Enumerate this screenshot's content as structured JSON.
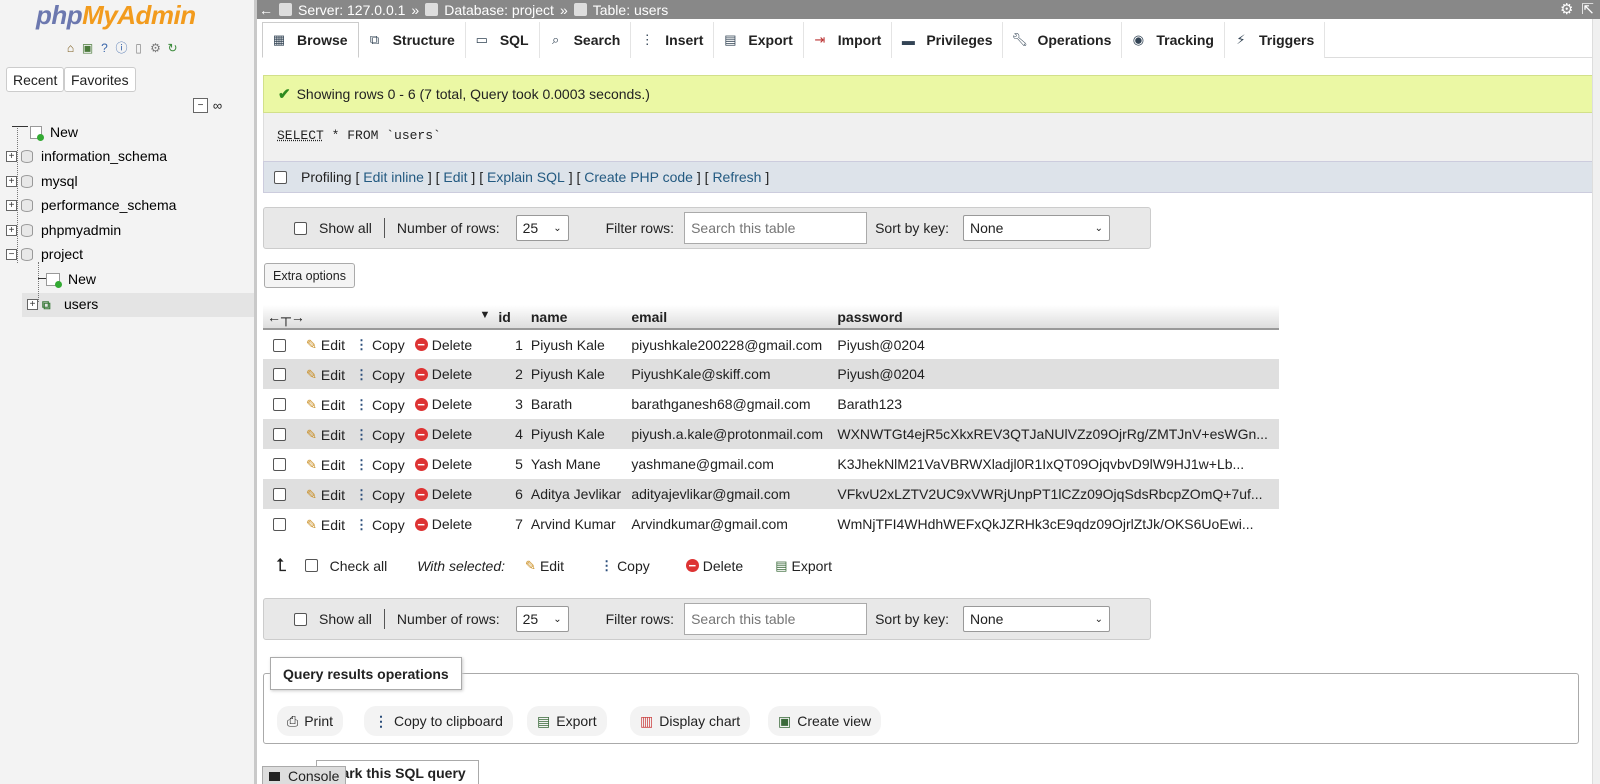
{
  "sidebar": {
    "logo_php": "php",
    "logo_myadmin": "MyAdmin",
    "recent_label": "Recent",
    "favorites_label": "Favorites",
    "tree": [
      {
        "label": "New"
      },
      {
        "label": "information_schema"
      },
      {
        "label": "mysql"
      },
      {
        "label": "performance_schema"
      },
      {
        "label": "phpmyadmin"
      },
      {
        "label": "project"
      },
      {
        "label": "New"
      },
      {
        "label": "users"
      }
    ]
  },
  "breadcrumb": {
    "server": "Server: 127.0.0.1",
    "database": "Database: project",
    "table": "Table: users",
    "separator": "»"
  },
  "tabs": [
    {
      "label": "Browse",
      "icon": "table-icon"
    },
    {
      "label": "Structure",
      "icon": "structure-icon"
    },
    {
      "label": "SQL",
      "icon": "sql-icon"
    },
    {
      "label": "Search",
      "icon": "search-icon"
    },
    {
      "label": "Insert",
      "icon": "insert-icon"
    },
    {
      "label": "Export",
      "icon": "export-icon"
    },
    {
      "label": "Import",
      "icon": "import-icon"
    },
    {
      "label": "Privileges",
      "icon": "privileges-icon"
    },
    {
      "label": "Operations",
      "icon": "wrench-icon"
    },
    {
      "label": "Tracking",
      "icon": "eye-icon"
    },
    {
      "label": "Triggers",
      "icon": "triggers-icon"
    }
  ],
  "message": {
    "success": "Showing rows 0 - 6 (7 total, Query took 0.0003 seconds.)"
  },
  "sql": {
    "select": "SELECT",
    "rest": " * FROM `users`"
  },
  "profiling": {
    "label": "Profiling",
    "edit_inline": "Edit inline",
    "edit": "Edit",
    "explain": "Explain SQL",
    "create_php": "Create PHP code",
    "refresh": "Refresh"
  },
  "navigation": {
    "show_all": "Show all",
    "number_of_rows_label": "Number of rows:",
    "number_of_rows_value": "25",
    "filter_label": "Filter rows:",
    "filter_placeholder": "Search this table",
    "sort_label": "Sort by key:",
    "sort_value": "None"
  },
  "extra_options": "Extra options",
  "table": {
    "columns": [
      "id",
      "name",
      "email",
      "password"
    ],
    "actions": {
      "edit": "Edit",
      "copy": "Copy",
      "delete": "Delete"
    },
    "rows": [
      {
        "id": "1",
        "name": "Piyush Kale",
        "email": "piyushkale200228@gmail.com",
        "password": "Piyush@0204"
      },
      {
        "id": "2",
        "name": "Piyush Kale",
        "email": "PiyushKale@skiff.com",
        "password": "Piyush@0204"
      },
      {
        "id": "3",
        "name": "Barath",
        "email": "barathganesh68@gmail.com",
        "password": "Barath123"
      },
      {
        "id": "4",
        "name": "Piyush Kale",
        "email": "piyush.a.kale@protonmail.com",
        "password": "WXNWTGt4ejR5cXkxREV3QTJaNUlVZz09OjrRg/ZMTJnV+esWGn..."
      },
      {
        "id": "5",
        "name": "Yash Mane",
        "email": "yashmane@gmail.com",
        "password": "K3JhekNlM21VaVBRWXladjl0R1IxQT09OjqvbvD9lW9HJ1w+Lb..."
      },
      {
        "id": "6",
        "name": "Aditya Jevlikar",
        "email": "adityajevlikar@gmail.com",
        "password": "VFkvU2xLZTV2UC9xVWRjUnpPT1lCZz09OjqSdsRbcpZOmQ+7uf..."
      },
      {
        "id": "7",
        "name": "Arvind Kumar",
        "email": "Arvindkumar@gmail.com",
        "password": "WmNjTFI4WHdhWEFxQkJZRHk3cE9qdz09OjrlZtJk/OKS6UoEwi..."
      }
    ]
  },
  "with_selected": {
    "check_all": "Check all",
    "label": "With selected:",
    "edit": "Edit",
    "copy": "Copy",
    "delete": "Delete",
    "export": "Export"
  },
  "query_ops": {
    "title": "Query results operations",
    "print": "Print",
    "copy_clipboard": "Copy to clipboard",
    "export": "Export",
    "display_chart": "Display chart",
    "create_view": "Create view"
  },
  "bookmark": "mark this SQL query",
  "console": "Console"
}
